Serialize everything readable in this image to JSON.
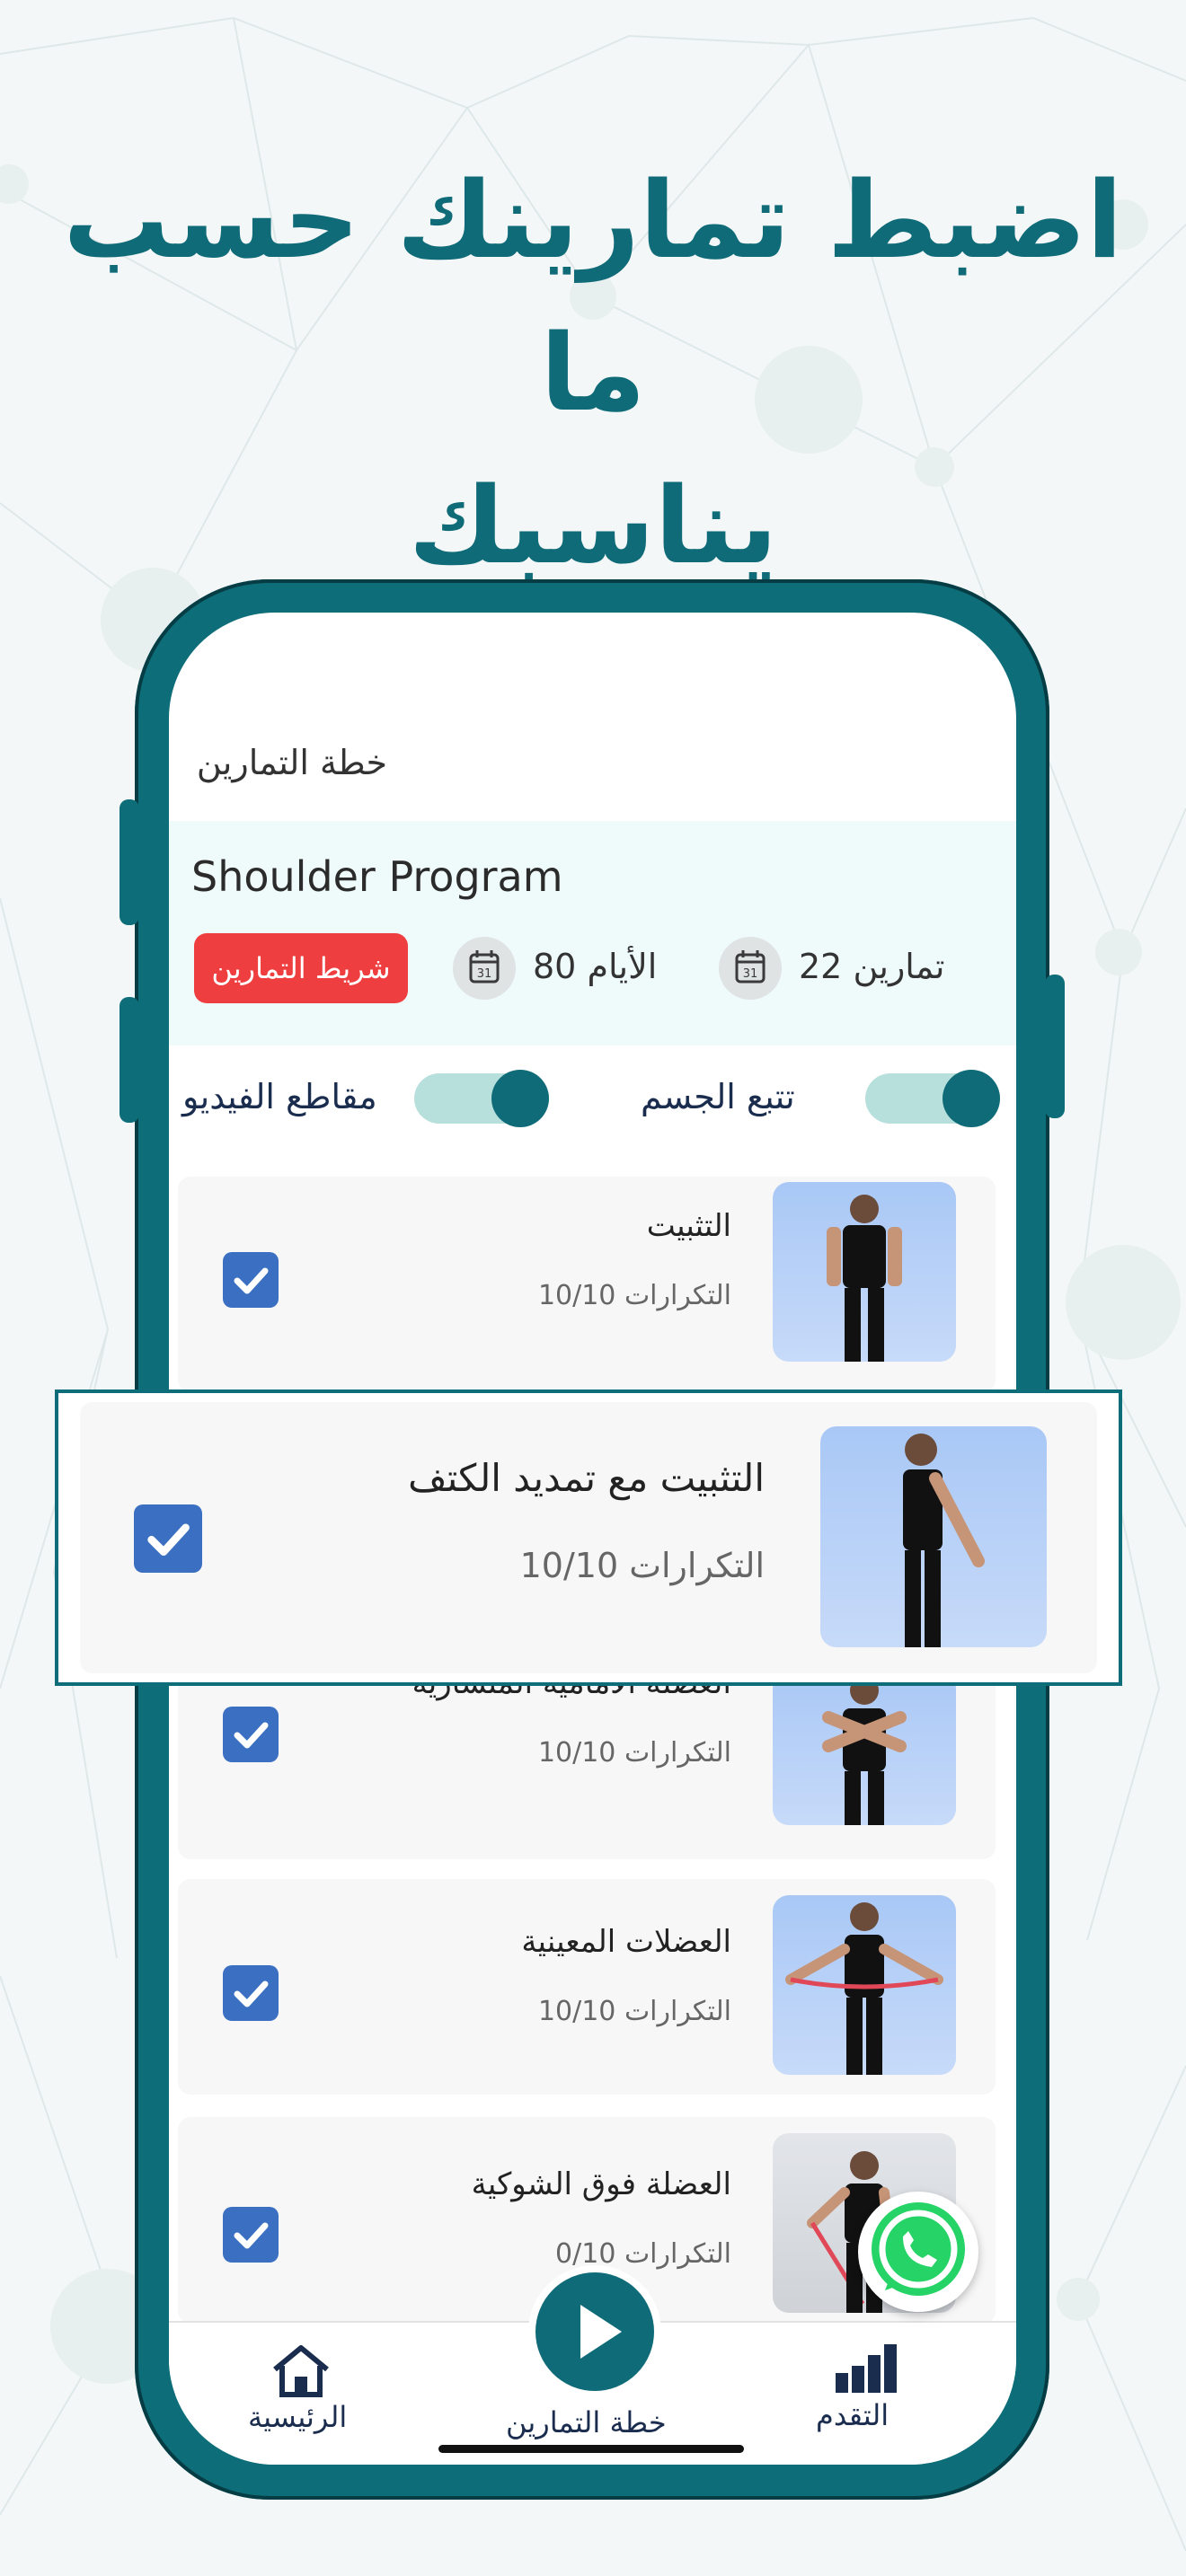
{
  "headline": {
    "line1": "اضبط تمارينك حسب ما",
    "line2": "يناسبك"
  },
  "screen": {
    "title": "خطة التمارين",
    "program": {
      "name": "Shoulder Program",
      "exercises_stat": "تمارين  22",
      "days_stat": "الأيام  80",
      "tape_button": "شريط التمارين"
    },
    "toggles": {
      "body_tracking": "تتبع الجسم",
      "video_clips": "مقاطع الفيديو"
    },
    "exercises": [
      {
        "title": "التثبيت",
        "reps": "التكرارات  10/10"
      },
      {
        "title": "التثبيت مع تمديد الكتف",
        "reps": "التكرارات  10/10"
      },
      {
        "title": "العضلة الأمامية المنشارية",
        "reps": "التكرارات  10/10"
      },
      {
        "title": "العضلات المعينية",
        "reps": "التكرارات  10/10"
      },
      {
        "title": "العضلة فوق الشوكية",
        "reps": "التكرارات  0/10"
      }
    ],
    "nav": {
      "home": "الرئيسية",
      "plan": "خطة التمارين",
      "progress": "التقدم"
    }
  },
  "colors": {
    "brand": "#0f6b78",
    "accent_red": "#ef3e3f",
    "check_blue": "#3a6fc1",
    "toggle_track": "#b7e0dc",
    "whatsapp": "#25d366"
  },
  "icons": [
    "calendar-icon",
    "check-icon",
    "home-icon",
    "play-icon",
    "bar-chart-icon",
    "whatsapp-icon"
  ]
}
